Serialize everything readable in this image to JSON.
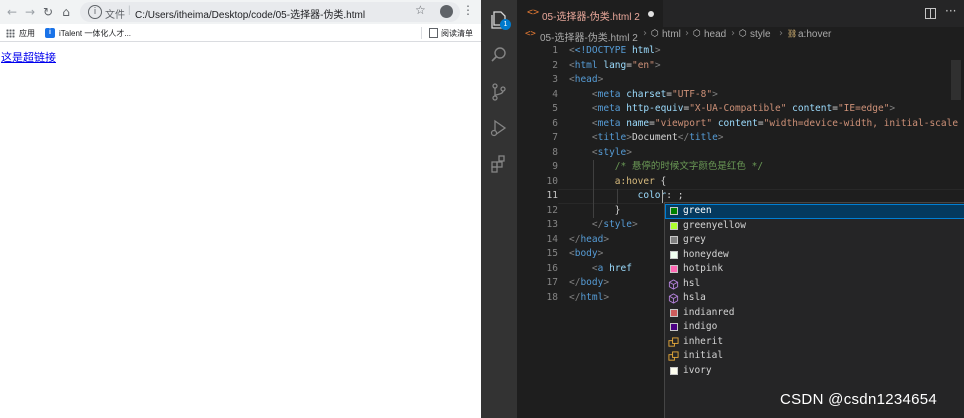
{
  "browser": {
    "omnibox": {
      "scheme": "文件",
      "url": "C:/Users/itheima/Desktop/code/05-选择器-伪类.html"
    },
    "bookmarks": {
      "apps_label": "应用",
      "itab_label": "iTalent 一体化人才...",
      "reading_list_label": "阅读清单"
    },
    "page": {
      "link_text": "这是超链接"
    }
  },
  "vscode": {
    "tab": {
      "label": "05-选择器-伪类.html 2"
    },
    "breadcrumbs": [
      "html",
      "head",
      "style",
      "a:hover"
    ],
    "editor": {
      "lines": [
        {
          "n": "1"
        },
        {
          "n": "2"
        },
        {
          "n": "3"
        },
        {
          "n": "4"
        },
        {
          "n": "5"
        },
        {
          "n": "6"
        },
        {
          "n": "7"
        },
        {
          "n": "8"
        },
        {
          "n": "9"
        },
        {
          "n": "10"
        },
        {
          "n": "11"
        },
        {
          "n": "12"
        },
        {
          "n": "13"
        },
        {
          "n": "14"
        },
        {
          "n": "15"
        },
        {
          "n": "16"
        },
        {
          "n": "17"
        },
        {
          "n": "18"
        }
      ],
      "code": {
        "l1_doctype": "<!DOCTYPE ",
        "l1_html": "html",
        "l2_lang_val": "\"en\"",
        "l4_charset_val": "\"UTF-8\"",
        "l5_equiv_val": "\"X-UA-Compatible\"",
        "l5_content_val": "\"IE=edge\"",
        "l6_name_val": "\"viewport\"",
        "l6_content_val": "\"width=device-width, initial-scale",
        "l7_title_text": "Document",
        "l9_comment": "/* 悬停的时候文字颜色是红色 */",
        "l10_selector": "a:hover",
        "l11_prop": "color",
        "l16_attr": "href"
      }
    },
    "suggest": {
      "items": [
        {
          "label": "green",
          "kind": "color",
          "color": "#008000"
        },
        {
          "label": "greenyellow",
          "kind": "color",
          "color": "#adff2f"
        },
        {
          "label": "grey",
          "kind": "color",
          "color": "#808080"
        },
        {
          "label": "honeydew",
          "kind": "color",
          "color": "#f0fff0"
        },
        {
          "label": "hotpink",
          "kind": "color",
          "color": "#ff69b4"
        },
        {
          "label": "hsl",
          "kind": "function-icon"
        },
        {
          "label": "hsla",
          "kind": "function-icon"
        },
        {
          "label": "indianred",
          "kind": "color",
          "color": "#cd5c5c"
        },
        {
          "label": "indigo",
          "kind": "color",
          "color": "#4b0082"
        },
        {
          "label": "inherit",
          "kind": "keyword-icon"
        },
        {
          "label": "initial",
          "kind": "keyword-icon"
        },
        {
          "label": "ivory",
          "kind": "color",
          "color": "#fffff0"
        }
      ]
    }
  },
  "watermark": "CSDN @csdn1234654"
}
